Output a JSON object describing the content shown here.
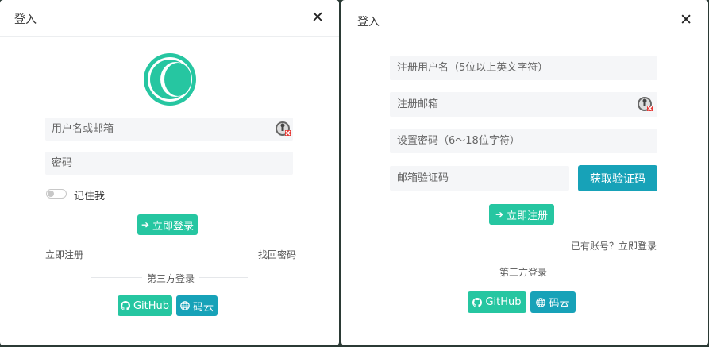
{
  "login": {
    "title": "登入",
    "username_placeholder": "用户名或邮箱",
    "password_placeholder": "密码",
    "remember_label": "记住我",
    "remember_checked": false,
    "submit_label": "立即登录",
    "register_link": "立即注册",
    "forgot_link": "找回密码",
    "third_party_label": "第三方登录",
    "github_label": "GitHub",
    "gitee_label": "码云"
  },
  "register": {
    "title": "登入",
    "username_placeholder": "注册用户名（5位以上英文字符）",
    "email_placeholder": "注册邮箱",
    "password_placeholder": "设置密码（6～18位字符）",
    "code_placeholder": "邮箱验证码",
    "get_code_label": "获取验证码",
    "submit_label": "立即注册",
    "login_prompt": "已有账号？立即登录",
    "third_party_label": "第三方登录",
    "github_label": "GitHub",
    "gitee_label": "码云"
  },
  "colors": {
    "primary_green": "#26c6a1",
    "teal": "#17a2b8",
    "field_bg": "#f5f6f8"
  },
  "icons": {
    "close": "close-icon",
    "logo": "logo-icon",
    "password_manager": "password-key-icon",
    "sign_in": "sign-in-icon",
    "github": "github-icon",
    "globe": "globe-icon"
  }
}
